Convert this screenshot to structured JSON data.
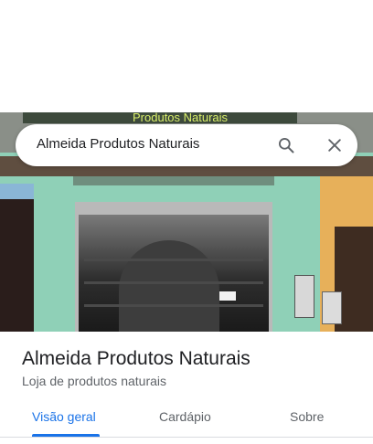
{
  "search": {
    "query": "Almeida Produtos Naturais",
    "search_icon": "search-icon",
    "clear_icon": "close-icon"
  },
  "photo": {
    "storefront_sign": "Produtos Naturais"
  },
  "place": {
    "name": "Almeida Produtos Naturais",
    "category": "Loja de produtos naturais"
  },
  "tabs": [
    {
      "label": "Visão geral",
      "selected": true
    },
    {
      "label": "Cardápio",
      "selected": false
    },
    {
      "label": "Sobre",
      "selected": false
    }
  ],
  "colors": {
    "accent": "#1a73e8",
    "text_primary": "#202124",
    "text_secondary": "#5f6368"
  }
}
